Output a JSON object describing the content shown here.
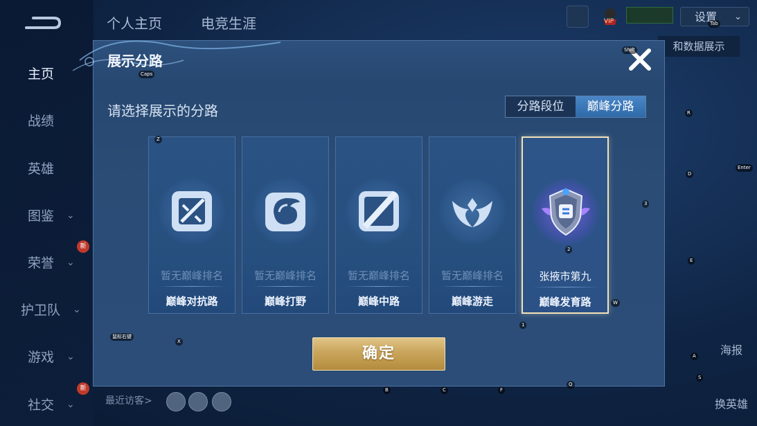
{
  "sidebar": {
    "items": [
      {
        "label": "主页"
      },
      {
        "label": "战绩"
      },
      {
        "label": "英雄"
      },
      {
        "label": "图鉴"
      },
      {
        "label": "荣誉",
        "badge": "新"
      },
      {
        "label": "护卫队"
      },
      {
        "label": "游戏"
      },
      {
        "label": "社交",
        "badge": "新"
      }
    ]
  },
  "top_tabs": [
    "个人主页",
    "电竞生涯"
  ],
  "topbar": {
    "settings_label": "设置",
    "vip_label": "VIP",
    "data_display_label": "和数据展示"
  },
  "right_panel": {
    "poster_label": "海报",
    "change_hero_label": "换英雄"
  },
  "recent_visitors_label": "最近访客>",
  "modal": {
    "title": "展示分路",
    "subtitle": "请选择展示的分路",
    "toggle": [
      "分路段位",
      "巅峰分路"
    ],
    "toggle_active": 1,
    "cards": [
      {
        "rank": "暂无巅峰排名",
        "role": "巅峰对抗路",
        "icon": "sword-emblem-icon"
      },
      {
        "rank": "暂无巅峰排名",
        "role": "巅峰打野",
        "icon": "dragon-emblem-icon"
      },
      {
        "rank": "暂无巅峰排名",
        "role": "巅峰中路",
        "icon": "staff-emblem-icon"
      },
      {
        "rank": "暂无巅峰排名",
        "role": "巅峰游走",
        "icon": "wings-emblem-icon"
      },
      {
        "rank": "张掖市第九",
        "role": "巅峰发育路",
        "icon": "shield-crest-icon",
        "selected": true
      }
    ],
    "confirm_label": "确定"
  },
  "key_hints": {
    "caps": "Caps",
    "shift": "Shift",
    "tab": "Tab",
    "z": "Z",
    "x": "X",
    "r": "R",
    "d": "D",
    "enter": "Enter",
    "three": "3",
    "two": "2",
    "e": "E",
    "w": "W",
    "one": "1",
    "mouse_right": "鼠标右键",
    "b": "B",
    "c": "C",
    "f": "F",
    "q": "Q",
    "a": "A",
    "s": "S"
  },
  "colors": {
    "modal_bg": "#2a4c75",
    "toggle_active": "#3a78b8",
    "confirm_gold": "#c9a55b",
    "selected_border": "#f2e3b8"
  }
}
